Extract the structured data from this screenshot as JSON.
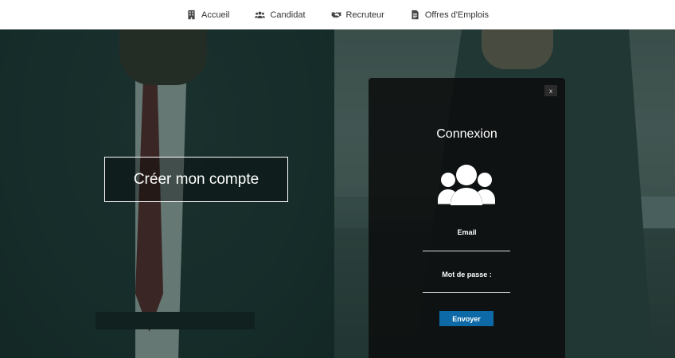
{
  "nav": {
    "items": [
      {
        "label": "Accueil",
        "icon": "building-icon"
      },
      {
        "label": "Candidat",
        "icon": "users-icon"
      },
      {
        "label": "Recruteur",
        "icon": "handshake-icon"
      },
      {
        "label": "Offres d'Emplois",
        "icon": "document-icon"
      }
    ]
  },
  "hero": {
    "create_account_label": "Créer mon compte"
  },
  "login": {
    "close_label": "x",
    "title": "Connexion",
    "icon": "users-icon",
    "email_label": "Email",
    "email_value": "",
    "password_label": "Mot de passe :",
    "password_value": "",
    "submit_label": "Envoyer"
  },
  "colors": {
    "overlay": "#12302c",
    "submit_button": "#0d6aa6",
    "navbar": "#ffffff"
  }
}
